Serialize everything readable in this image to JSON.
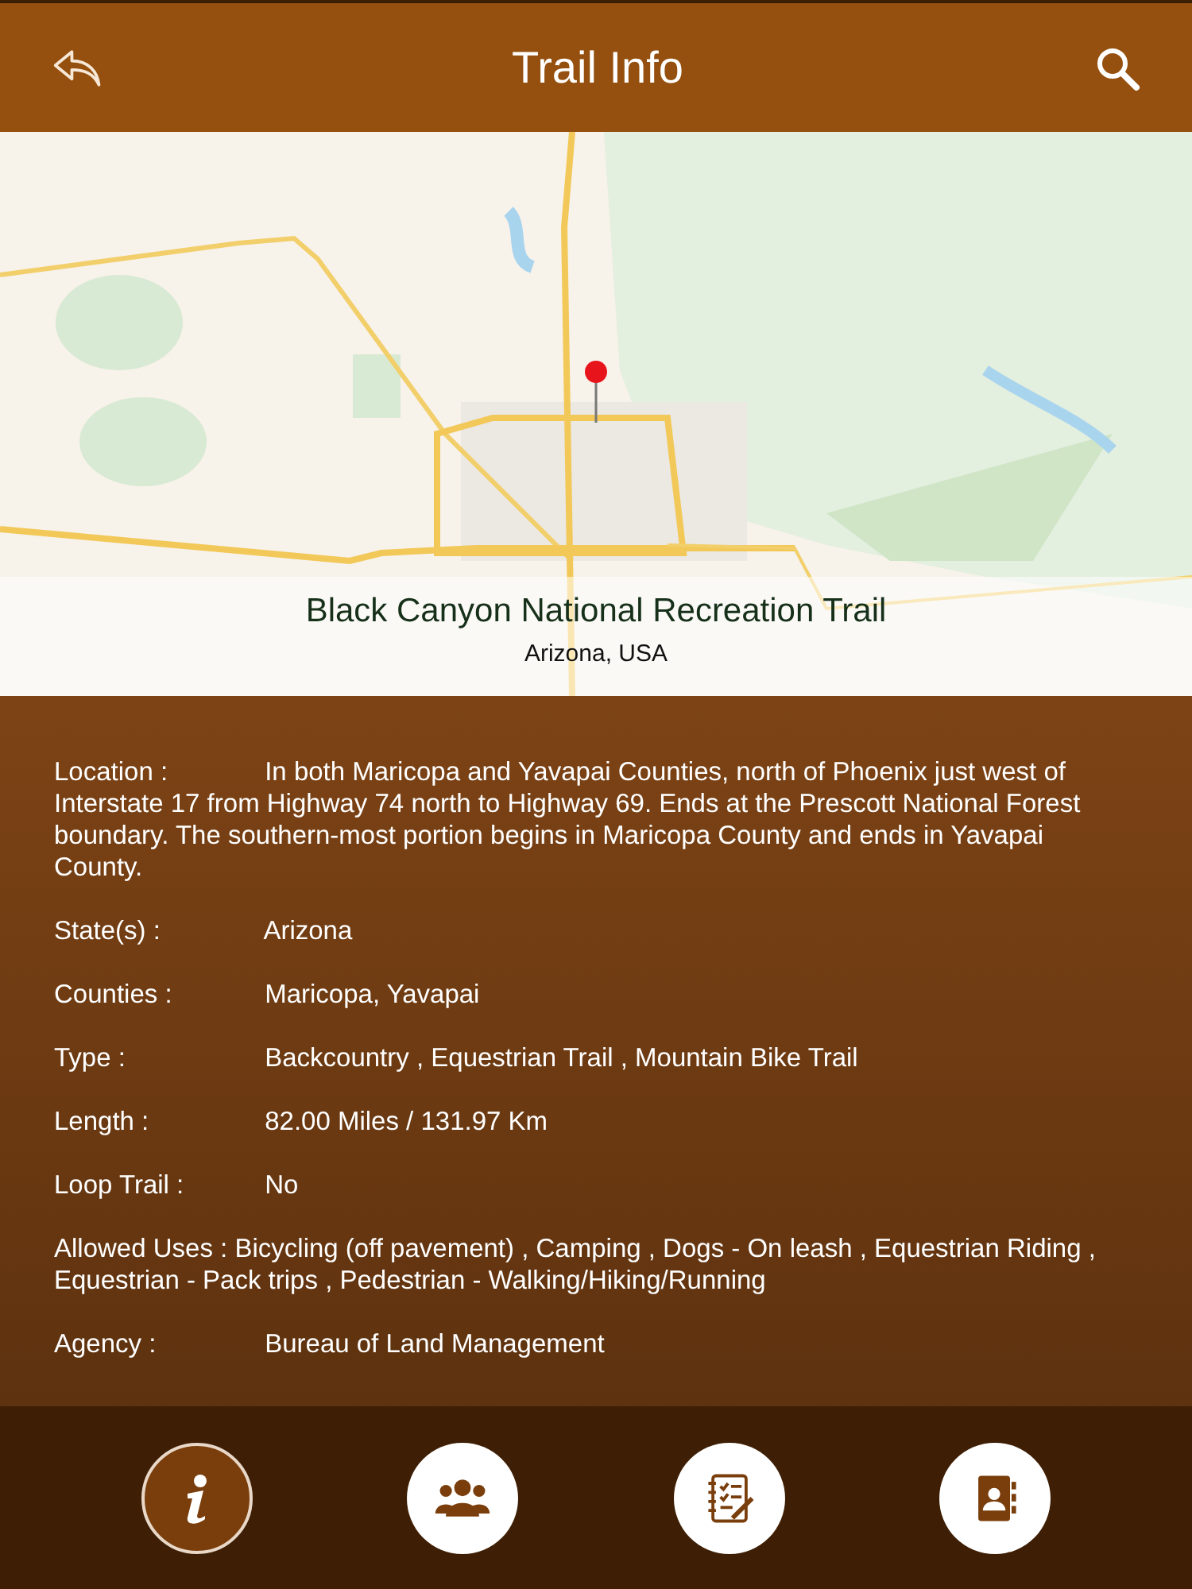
{
  "header": {
    "title": "Trail Info"
  },
  "map": {
    "pin": true,
    "trail_name": "Black Canyon National Recreation Trail",
    "region": "Arizona, USA"
  },
  "details": [
    {
      "label": "Location  :",
      "value": "In both Maricopa and Yavapai Counties, north of Phoenix just west of Interstate 17 from Highway 74 north to Highway 69. Ends at the Prescott National Forest boundary. The southern-most portion begins in Maricopa County and ends in Yavapai County."
    },
    {
      "label": "State(s)  :",
      "value": "Arizona"
    },
    {
      "label": "Counties  :",
      "value": "Maricopa, Yavapai"
    },
    {
      "label": "Type  :",
      "value": "Backcountry , Equestrian Trail , Mountain Bike Trail"
    },
    {
      "label": "Length  :",
      "value": "82.00 Miles / 131.97 Km"
    },
    {
      "label": "Loop Trail  :",
      "value": "No"
    },
    {
      "label": "Allowed Uses  :",
      "value": "Bicycling (off pavement) , Camping , Dogs - On leash , Equestrian Riding , Equestrian - Pack trips , Pedestrian - Walking/Hiking/Running",
      "kind": "paragraph"
    },
    {
      "label": "Agency  :",
      "value": "Bureau of Land Management"
    }
  ],
  "tabs": [
    {
      "kind": "info",
      "selected": true
    },
    {
      "kind": "people",
      "selected": false
    },
    {
      "kind": "notes",
      "selected": false
    },
    {
      "kind": "contacts",
      "selected": false
    }
  ]
}
